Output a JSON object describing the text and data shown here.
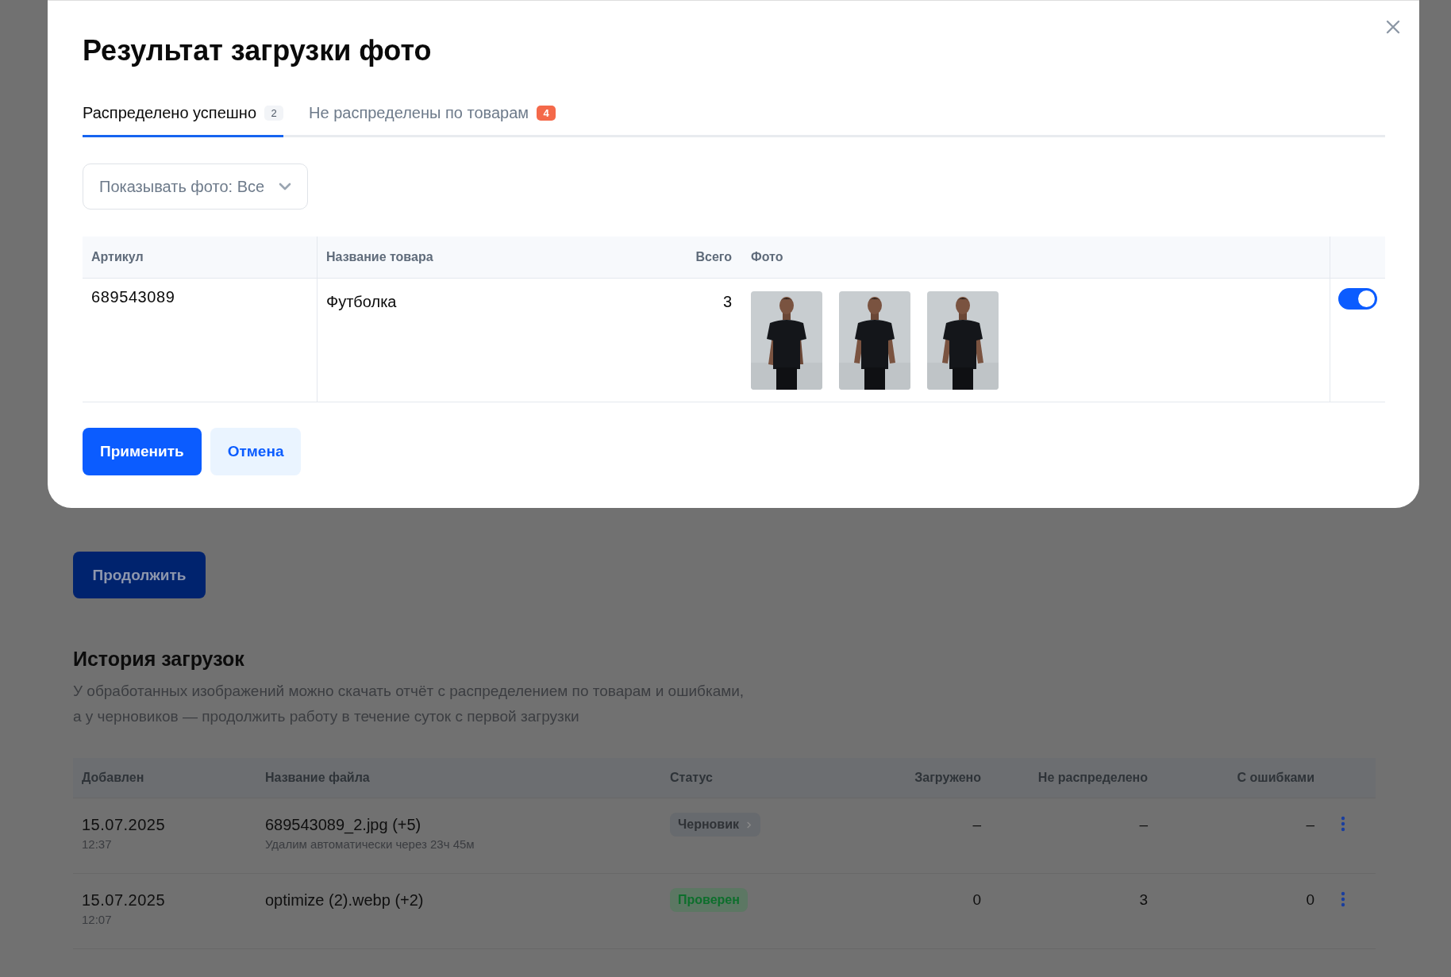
{
  "page": {
    "continue_button": "Продолжить",
    "history": {
      "title": "История загрузок",
      "description": [
        "У обработанных изображений можно скачать отчёт с распределением по товарам и ошибками,",
        "а у черновиков — продолжить работу в течение суток с первой загрузки"
      ],
      "columns": [
        "Добавлен",
        "Название файла",
        "Статус",
        "Загружено",
        "Не распределено",
        "С ошибками"
      ],
      "rows": [
        {
          "date": "15.07.2025",
          "time": "12:37",
          "file": "689543089_2.jpg (+5)",
          "note": "Удалим автоматически через 23ч 45м",
          "status": {
            "label": "Черновик",
            "kind": "draft"
          },
          "uploaded": "–",
          "unassigned": "–",
          "errors": "–"
        },
        {
          "date": "15.07.2025",
          "time": "12:07",
          "file": "optimize (2).webp (+2)",
          "status": {
            "label": "Проверен",
            "kind": "verified"
          },
          "uploaded": "0",
          "unassigned": "3",
          "errors": "0"
        }
      ]
    }
  },
  "dialog": {
    "title": "Результат загрузки фото",
    "tabs": [
      {
        "label": "Распределено успешно",
        "count": "2",
        "selected": true
      },
      {
        "label": "Не распределены по товарам",
        "count": "4",
        "selected": false
      }
    ],
    "filter": {
      "value": "Показывать фото: Все"
    },
    "table": {
      "columns": [
        "Артикул",
        "Название товара",
        "Всего",
        "Фото"
      ],
      "rows": [
        {
          "article": "689543089",
          "name": "Футболка",
          "total": "3",
          "on": true
        }
      ]
    },
    "buttons": [
      "Применить",
      "Отмена"
    ]
  }
}
